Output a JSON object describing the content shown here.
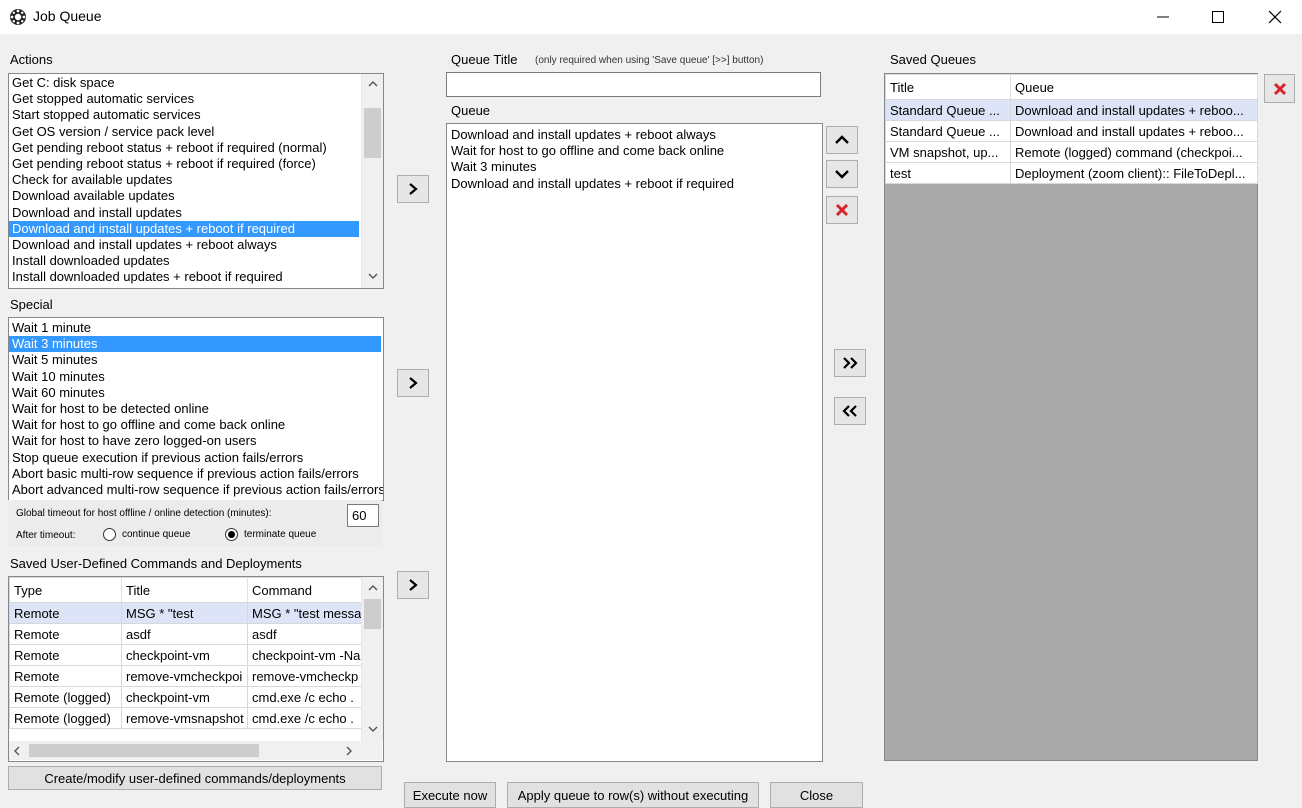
{
  "window": {
    "title": "Job Queue"
  },
  "actions": {
    "label": "Actions",
    "items": [
      "Get C: disk space",
      "Get stopped automatic services",
      "Start stopped automatic services",
      "Get OS version / service pack level",
      "Get pending reboot status + reboot if required (normal)",
      "Get pending reboot status + reboot if required (force)",
      "Check for available updates",
      "Download available updates",
      "Download and install updates",
      "Download and install updates + reboot if required",
      "Download and install updates + reboot always",
      "Install downloaded updates",
      "Install downloaded updates + reboot if required"
    ]
  },
  "special": {
    "label": "Special",
    "items": [
      "Wait 1 minute",
      "Wait 3 minutes",
      "Wait 5 minutes",
      "Wait 10 minutes",
      "Wait 60 minutes",
      "Wait for host to be detected online",
      "Wait for host to go offline and come back online",
      "Wait for host to have zero logged-on users",
      "Stop queue execution if previous action fails/errors",
      "Abort basic multi-row sequence if previous action fails/errors",
      "Abort advanced multi-row sequence if previous action fails/errors"
    ]
  },
  "timeout": {
    "label": "Global timeout for host offline / online detection (minutes):",
    "value": "60",
    "after_label": "After timeout:",
    "continue_label": "continue queue",
    "terminate_label": "terminate queue"
  },
  "saved_commands": {
    "label": "Saved User-Defined Commands and Deployments",
    "headers": [
      "Type",
      "Title",
      "Command"
    ],
    "rows": [
      [
        "Remote",
        "MSG * \"test",
        "MSG * \"test messa"
      ],
      [
        "Remote",
        "asdf",
        "asdf"
      ],
      [
        "Remote",
        "checkpoint-vm",
        "checkpoint-vm -Na"
      ],
      [
        "Remote",
        "remove-vmcheckpoi",
        "remove-vmcheckp"
      ],
      [
        "Remote (logged)",
        "checkpoint-vm",
        "cmd.exe /c echo ."
      ],
      [
        "Remote (logged)",
        "remove-vmsnapshot",
        "cmd.exe /c echo ."
      ]
    ],
    "create_button": "Create/modify user-defined commands/deployments"
  },
  "queue": {
    "title_label": "Queue Title",
    "title_hint": "(only required when using 'Save queue' [>>] button)",
    "title_value": "",
    "label": "Queue",
    "items": [
      "Download and install updates + reboot always",
      "Wait for host to go offline and come back online",
      "Wait 3 minutes",
      "Download and install updates + reboot if required"
    ]
  },
  "saved_queues": {
    "label": "Saved Queues",
    "headers": [
      "Title",
      "Queue"
    ],
    "rows": [
      [
        "Standard Queue ...",
        "Download and install updates + reboo..."
      ],
      [
        "Standard Queue ...",
        "Download and install updates + reboo..."
      ],
      [
        "VM snapshot, up...",
        "Remote (logged) command (checkpoi..."
      ],
      [
        "test",
        "Deployment (zoom client):: FileToDepl..."
      ]
    ]
  },
  "buttons": {
    "execute": "Execute now",
    "apply": "Apply queue to row(s) without executing",
    "close": "Close"
  },
  "colors": {
    "selection": "#3399ff",
    "row_highlight": "#dde4f7",
    "delete_red": "#d9232b"
  }
}
